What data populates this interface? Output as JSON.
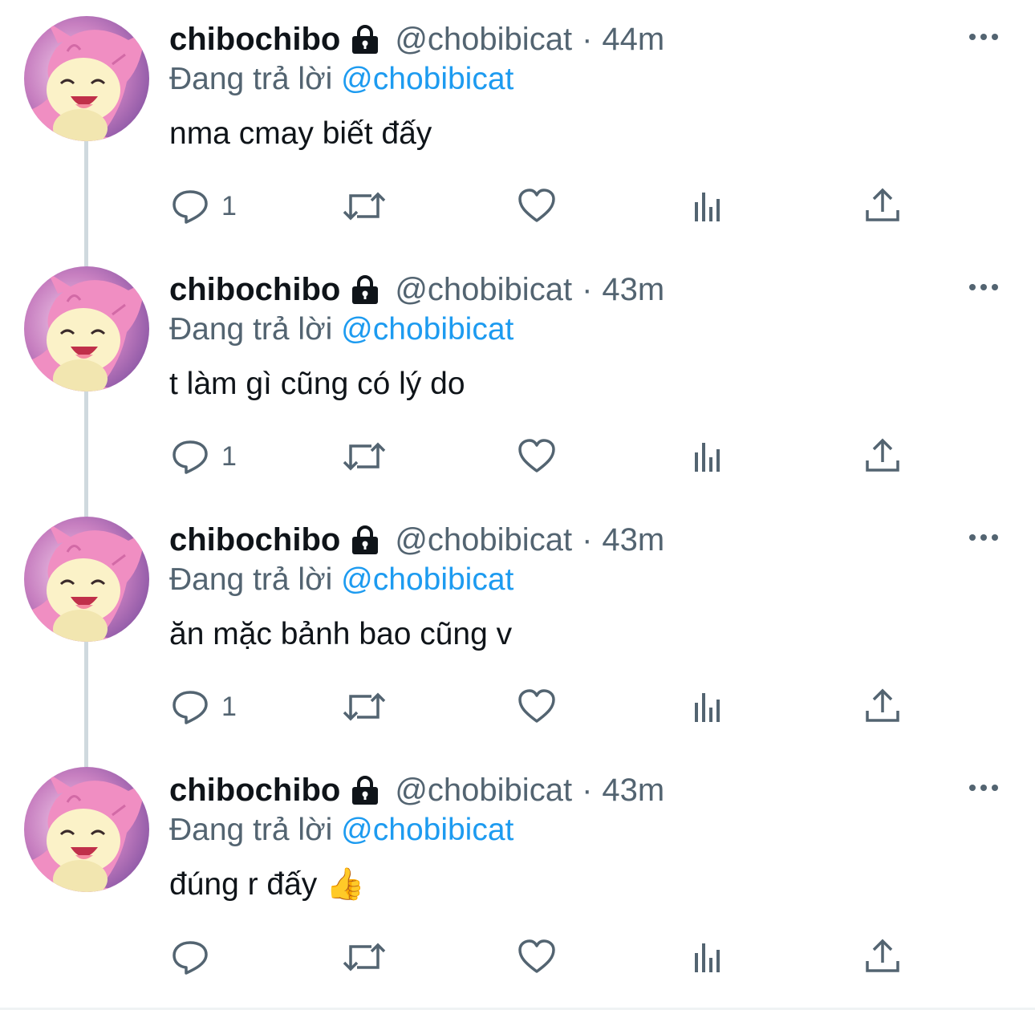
{
  "colors": {
    "text_primary": "#0f1419",
    "text_secondary": "#536471",
    "link": "#1d9bf0",
    "thread_line": "#cfd9de"
  },
  "tweets": [
    {
      "display_name": "chibochibo",
      "handle": "@chobibicat",
      "separator": "·",
      "time": "44m",
      "reply_prefix": "Đang trả lời",
      "reply_to": "@chobibicat",
      "text": "nma cmay biết đấy",
      "reply_count": "1",
      "icons": [
        "lock-icon",
        "more-icon",
        "reply-icon",
        "retweet-icon",
        "like-icon",
        "views-icon",
        "share-icon"
      ]
    },
    {
      "display_name": "chibochibo",
      "handle": "@chobibicat",
      "separator": "·",
      "time": "43m",
      "reply_prefix": "Đang trả lời",
      "reply_to": "@chobibicat",
      "text": "t làm gì cũng có lý do",
      "reply_count": "1"
    },
    {
      "display_name": "chibochibo",
      "handle": "@chobibicat",
      "separator": "·",
      "time": "43m",
      "reply_prefix": "Đang trả lời",
      "reply_to": "@chobibicat",
      "text": "ăn mặc bảnh bao cũng v",
      "reply_count": "1"
    },
    {
      "display_name": "chibochibo",
      "handle": "@chobibicat",
      "separator": "·",
      "time": "43m",
      "reply_prefix": "Đang trả lời",
      "reply_to": "@chobibicat",
      "text": "đúng r đấy 👍",
      "reply_count": ""
    }
  ]
}
